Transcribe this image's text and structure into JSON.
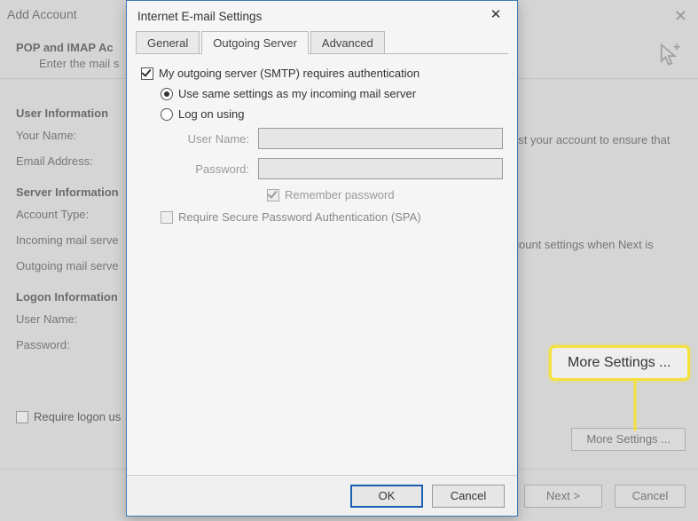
{
  "background": {
    "window_title": "Add Account",
    "header_title": "POP and IMAP Ac",
    "header_subtitle": "Enter the mail s",
    "sections": {
      "user_info": "User Information",
      "your_name": "Your Name:",
      "email_address": "Email Address:",
      "server_info": "Server Information",
      "account_type": "Account Type:",
      "incoming": "Incoming mail serve",
      "outgoing": "Outgoing mail serve",
      "logon_info": "Logon Information",
      "user_name": "User Name:",
      "password": "Password:"
    },
    "right_text1": "est your account to ensure that",
    "right_text2": "ccount settings when Next is",
    "require_logon": "Require logon us",
    "more_settings": "More Settings ...",
    "next": "Next >",
    "cancel": "Cancel"
  },
  "highlight": {
    "tag": "Outgoing Server",
    "more": "More Settings ..."
  },
  "modal": {
    "title": "Internet E-mail Settings",
    "tabs": {
      "general": "General",
      "outgoing": "Outgoing Server",
      "advanced": "Advanced"
    },
    "main_check": "My outgoing server (SMTP) requires authentication",
    "radio_same": "Use same settings as my incoming mail server",
    "radio_logon": "Log on using",
    "user_name_label": "User Name:",
    "password_label": "Password:",
    "remember_password": "Remember password",
    "spa": "Require Secure Password Authentication (SPA)",
    "ok": "OK",
    "cancel": "Cancel"
  }
}
